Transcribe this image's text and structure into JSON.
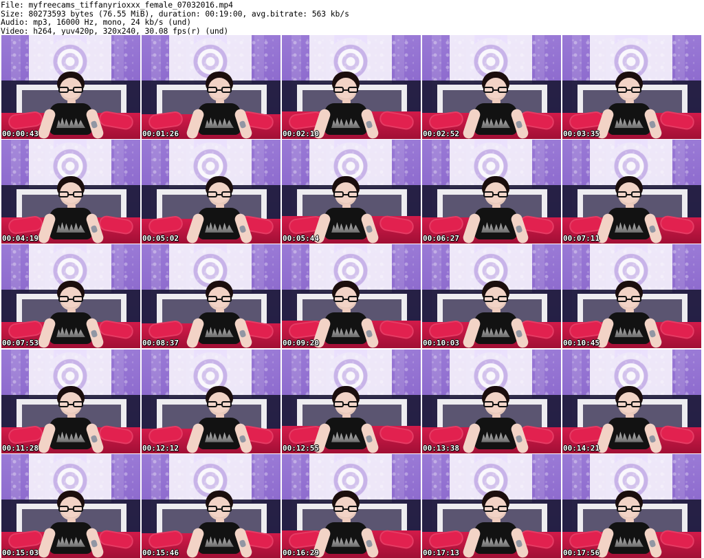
{
  "header": {
    "file": "File: myfreecams_tiffanyrioxxx_female_07032016.mp4",
    "size": "Size: 80273593 bytes (76.55 MiB), duration: 00:19:00, avg.bitrate: 563 kb/s",
    "audio": "Audio: mp3, 16000 Hz, mono, 24 kb/s (und)",
    "video": "Video: h264, yuv420p, 320x240, 30.08 fps(r) (und)"
  },
  "thumbnails": [
    {
      "timestamp": "00:00:43"
    },
    {
      "timestamp": "00:01:26"
    },
    {
      "timestamp": "00:02:10"
    },
    {
      "timestamp": "00:02:52"
    },
    {
      "timestamp": "00:03:35"
    },
    {
      "timestamp": "00:04:19"
    },
    {
      "timestamp": "00:05:02"
    },
    {
      "timestamp": "00:05:44"
    },
    {
      "timestamp": "00:06:27"
    },
    {
      "timestamp": "00:07:11"
    },
    {
      "timestamp": "00:07:53"
    },
    {
      "timestamp": "00:08:37"
    },
    {
      "timestamp": "00:09:20"
    },
    {
      "timestamp": "00:10:03"
    },
    {
      "timestamp": "00:10:45"
    },
    {
      "timestamp": "00:11:28"
    },
    {
      "timestamp": "00:12:12"
    },
    {
      "timestamp": "00:12:55"
    },
    {
      "timestamp": "00:13:38"
    },
    {
      "timestamp": "00:14:21"
    },
    {
      "timestamp": "00:15:03"
    },
    {
      "timestamp": "00:15:46"
    },
    {
      "timestamp": "00:16:29"
    },
    {
      "timestamp": "00:17:13"
    },
    {
      "timestamp": "00:17:56"
    }
  ]
}
